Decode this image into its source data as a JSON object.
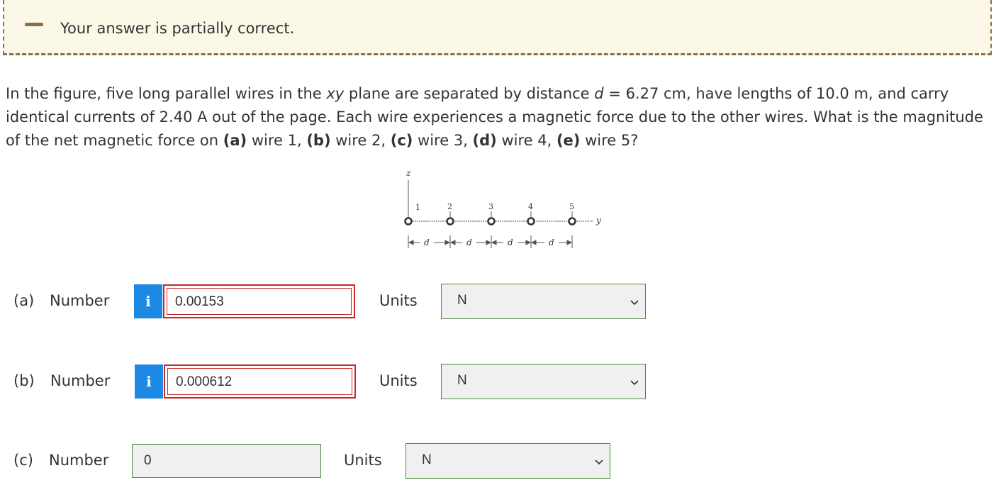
{
  "banner": {
    "message": "Your answer is partially correct."
  },
  "question": {
    "p1": "In the figure, five long parallel wires in the ",
    "xy": "xy",
    "p2": " plane are separated by distance ",
    "d": "d",
    "p3": " = 6.27 cm, have lengths of 10.0 m, and carry identical currents of 2.40 A out of the page. Each wire experiences a magnetic force due to the other wires. What is the magnitude of the net magnetic force on ",
    "a": "(a)",
    "p4": " wire 1, ",
    "b": "(b)",
    "p5": " wire 2, ",
    "c": "(c)",
    "p6": " wire 3, ",
    "dd": "(d)",
    "p7": " wire 4, ",
    "e": "(e)",
    "p8": " wire 5?"
  },
  "figure": {
    "z_label": "z",
    "y_label": "y",
    "wire_labels": [
      "1",
      "2",
      "3",
      "4",
      "5"
    ],
    "spacing_label": "d"
  },
  "parts": [
    {
      "part": "(a)",
      "number_label": "Number",
      "info_icon": "i",
      "value": "0.00153",
      "units_label": "Units",
      "unit": "N",
      "status": "incorrect"
    },
    {
      "part": "(b)",
      "number_label": "Number",
      "info_icon": "i",
      "value": "0.000612",
      "units_label": "Units",
      "unit": "N",
      "status": "incorrect"
    },
    {
      "part": "(c)",
      "number_label": "Number",
      "value": "0",
      "units_label": "Units",
      "unit": "N",
      "status": "correct"
    }
  ],
  "colors": {
    "banner_bg": "#fbf8e8",
    "banner_border": "#8a7044",
    "info_blue": "#1e88e5",
    "incorrect_red": "#c62828",
    "correct_green": "#4a8a3a"
  }
}
